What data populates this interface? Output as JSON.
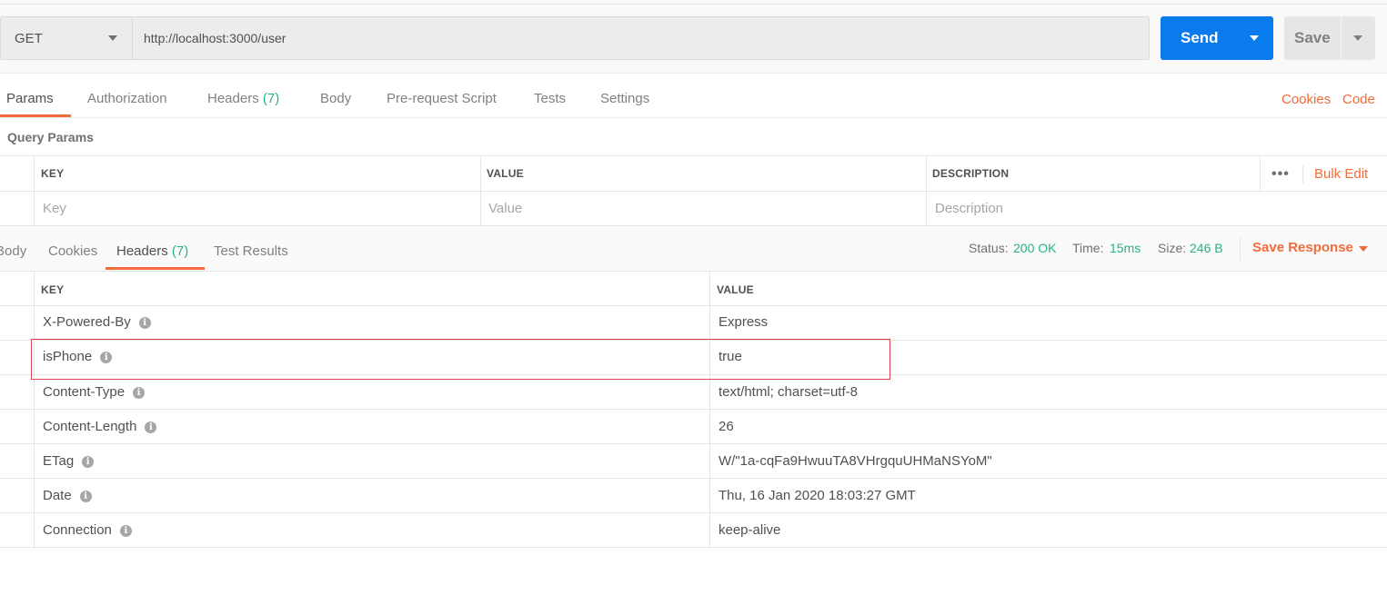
{
  "request": {
    "method": "GET",
    "url": "http://localhost:3000/user",
    "send_label": "Send",
    "save_label": "Save"
  },
  "request_tabs": [
    {
      "label": "Params",
      "count": ""
    },
    {
      "label": "Authorization",
      "count": ""
    },
    {
      "label": "Headers",
      "count": "(7)"
    },
    {
      "label": "Body",
      "count": ""
    },
    {
      "label": "Pre-request Script",
      "count": ""
    },
    {
      "label": "Tests",
      "count": ""
    },
    {
      "label": "Settings",
      "count": ""
    }
  ],
  "request_links": {
    "cookies": "Cookies",
    "code": "Code"
  },
  "query_params": {
    "title": "Query Params",
    "columns": {
      "key": "KEY",
      "value": "VALUE",
      "description": "DESCRIPTION"
    },
    "more": "•••",
    "bulk_edit": "Bulk Edit",
    "placeholders": {
      "key": "Key",
      "value": "Value",
      "description": "Description"
    }
  },
  "response_tabs": [
    {
      "label": "Body",
      "count": ""
    },
    {
      "label": "Cookies",
      "count": ""
    },
    {
      "label": "Headers",
      "count": "(7)"
    },
    {
      "label": "Test Results",
      "count": ""
    }
  ],
  "response_status": {
    "status_label": "Status:",
    "status_value": "200 OK",
    "time_label": "Time:",
    "time_value": "15ms",
    "size_label": "Size:",
    "size_value": "246 B",
    "save_response": "Save Response"
  },
  "response_headers": {
    "columns": {
      "key": "KEY",
      "value": "VALUE"
    },
    "rows": [
      {
        "key": "X-Powered-By",
        "value": "Express"
      },
      {
        "key": "isPhone",
        "value": "true"
      },
      {
        "key": "Content-Type",
        "value": "text/html; charset=utf-8"
      },
      {
        "key": "Content-Length",
        "value": "26"
      },
      {
        "key": "ETag",
        "value": "W/\"1a-cqFa9HwuuTA8VHrgquUHMaNSYoM\""
      },
      {
        "key": "Date",
        "value": "Thu, 16 Jan 2020 18:03:27 GMT"
      },
      {
        "key": "Connection",
        "value": "keep-alive"
      }
    ]
  },
  "colors": {
    "accent": "#f26b3a",
    "send": "#097bed",
    "success": "#26b47f",
    "highlight": "#e0424b"
  }
}
